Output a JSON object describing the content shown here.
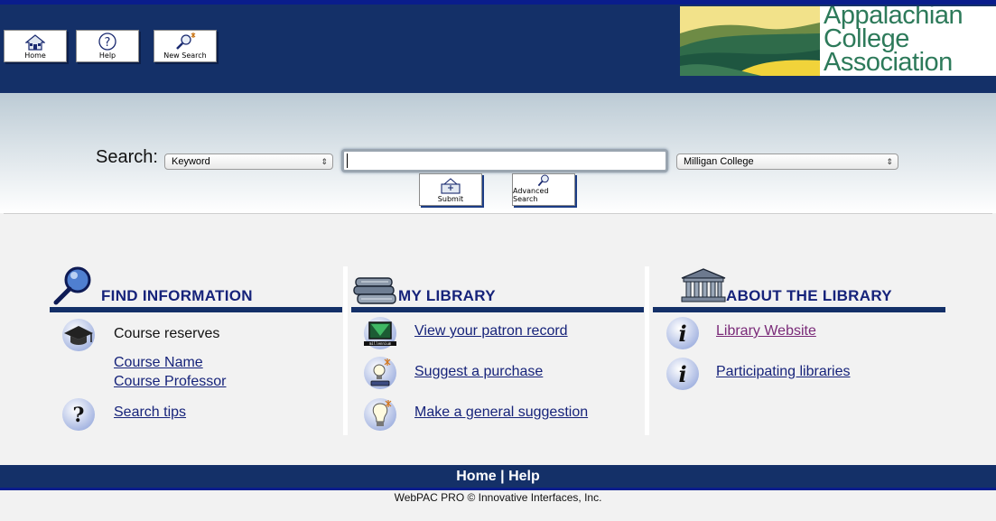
{
  "header": {
    "buttons": {
      "home": "Home",
      "help": "Help",
      "new_search": "New Search"
    },
    "logo": {
      "line1": "Appalachian",
      "line2": "College",
      "line3": "Association"
    }
  },
  "search": {
    "label": "Search:",
    "type_selected": "Keyword",
    "input_value": "",
    "library_selected": "Milligan College",
    "submit_label": "Submit",
    "advanced_label": "Advanced Search"
  },
  "find_information": {
    "heading": "FIND INFORMATION",
    "course_reserves": "Course reserves",
    "course_name": "Course Name",
    "course_professor": "Course Professor",
    "search_tips": "Search tips"
  },
  "my_library": {
    "heading": "MY LIBRARY",
    "items": [
      {
        "label": "View your patron record"
      },
      {
        "label": "Suggest a purchase"
      },
      {
        "label": "Make a general suggestion"
      }
    ]
  },
  "about_library": {
    "heading": "ABOUT THE LIBRARY",
    "items": [
      {
        "label": "Library Website"
      },
      {
        "label": "Participating libraries"
      }
    ]
  },
  "footer": {
    "home": "Home",
    "separator": "|",
    "help": "Help",
    "copyright": "WebPAC PRO © Innovative Interfaces, Inc."
  },
  "colors": {
    "header_bg": "#143068",
    "heading_text": "#16237a",
    "visited_link": "#7a2a78"
  }
}
